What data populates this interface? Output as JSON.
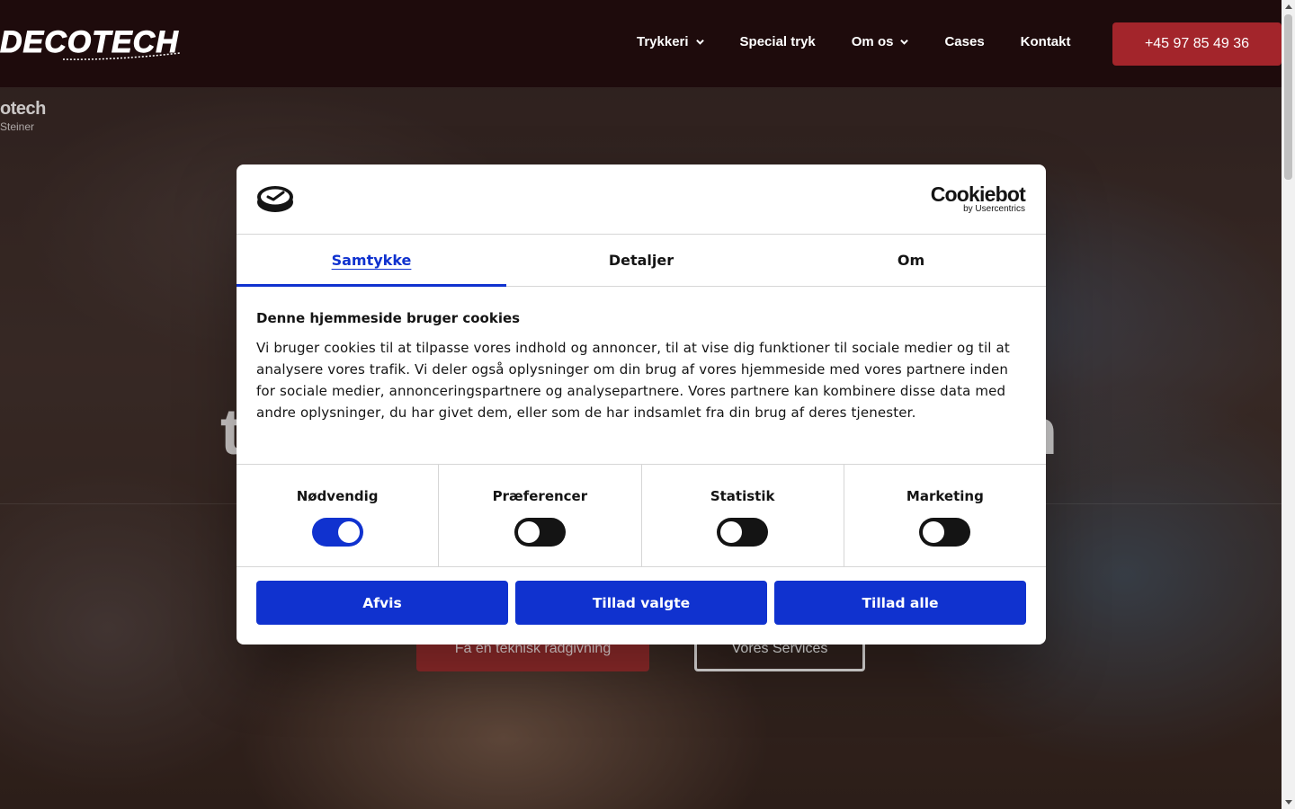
{
  "header": {
    "logo_text": "DECOTECH",
    "nav": [
      {
        "label": "Trykkeri",
        "has_dropdown": true
      },
      {
        "label": "Special tryk",
        "has_dropdown": false
      },
      {
        "label": "Om os",
        "has_dropdown": true
      },
      {
        "label": "Cases",
        "has_dropdown": false
      },
      {
        "label": "Kontakt",
        "has_dropdown": false
      }
    ],
    "phone_button": "+45 97 85 49 36"
  },
  "hero": {
    "video_title": "otech",
    "video_subtitle": "Steiner",
    "heading_left_fragment": "t",
    "heading_right_fragment": "n",
    "cta_primary": "Få en teknisk rådgivning",
    "cta_secondary": "Vores Services"
  },
  "cookie_dialog": {
    "brand_logo": "Cookiebot",
    "brand_sub": "by Usercentrics",
    "tabs": [
      {
        "label": "Samtykke",
        "active": true
      },
      {
        "label": "Detaljer",
        "active": false
      },
      {
        "label": "Om",
        "active": false
      }
    ],
    "title": "Denne hjemmeside bruger cookies",
    "body": "Vi bruger cookies til at tilpasse vores indhold og annoncer, til at vise dig funktioner til sociale medier og til at analysere vores trafik. Vi deler også oplysninger om din brug af vores hjemmeside med vores partnere inden for sociale medier, annonceringspartnere og analysepartnere. Vores partnere kan kombinere disse data med andre oplysninger, du har givet dem, eller som de har indsamlet fra din brug af deres tjenester.",
    "toggles": [
      {
        "label": "Nødvendig",
        "on": true
      },
      {
        "label": "Præferencer",
        "on": false
      },
      {
        "label": "Statistik",
        "on": false
      },
      {
        "label": "Marketing",
        "on": false
      }
    ],
    "buttons": {
      "deny": "Afvis",
      "allow_selected": "Tillad valgte",
      "allow_all": "Tillad alle"
    }
  },
  "colors": {
    "header_bg": "#1e0b0c",
    "accent_red": "#a3252b",
    "cookiebot_blue": "#1032cf"
  }
}
